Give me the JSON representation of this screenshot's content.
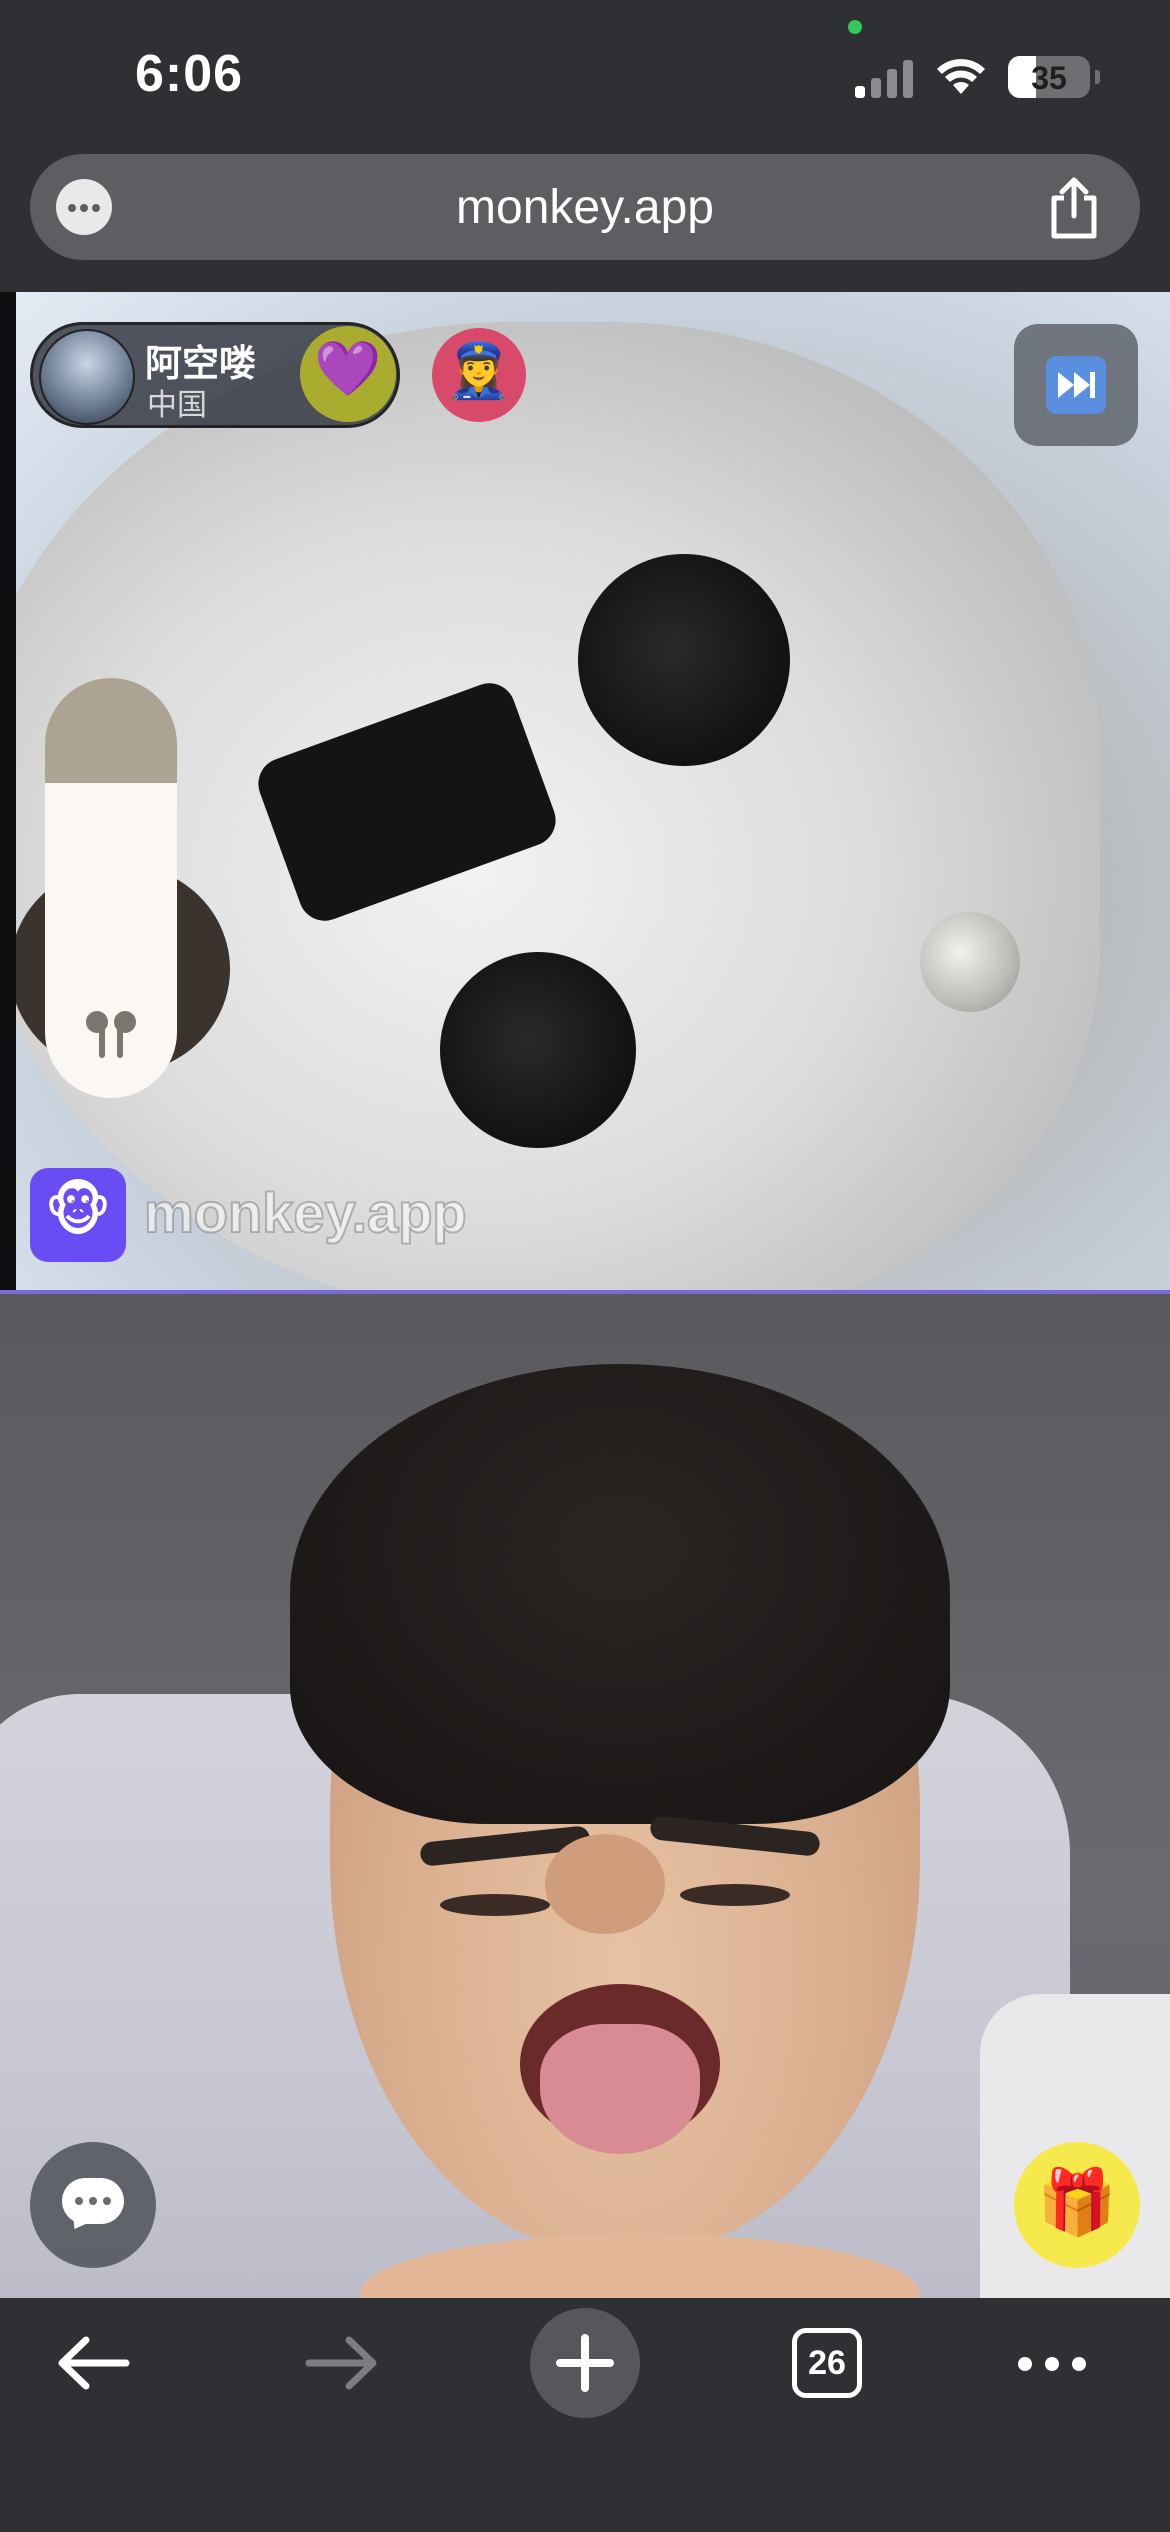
{
  "status_bar": {
    "time": "6:06",
    "battery_level": "35",
    "icons": [
      "cellular-signal-icon",
      "wifi-icon",
      "battery-icon"
    ]
  },
  "browser": {
    "url": "monkey.app",
    "tabs_count": "26",
    "icons": [
      "more-options-icon",
      "share-icon",
      "back-arrow-icon",
      "forward-arrow-icon",
      "new-tab-plus-icon",
      "tabs-icon",
      "menu-dots-icon"
    ]
  },
  "remote_user": {
    "name": "阿空喽",
    "country": "中国",
    "heart_emoji": "💜",
    "report_emoji": "👮‍♀️"
  },
  "watermark": {
    "logo_emoji": "🐵",
    "text": "monkey.app"
  },
  "controls": {
    "gift_emoji": "🎁",
    "volume_level": 0.75
  },
  "colors": {
    "accent_purple": "#6a4cf4",
    "heart_button": "#a9ac2e",
    "report_button": "#d94a6a",
    "gift_button": "#f6e94b",
    "toolbar_bg": "#2f3033"
  }
}
